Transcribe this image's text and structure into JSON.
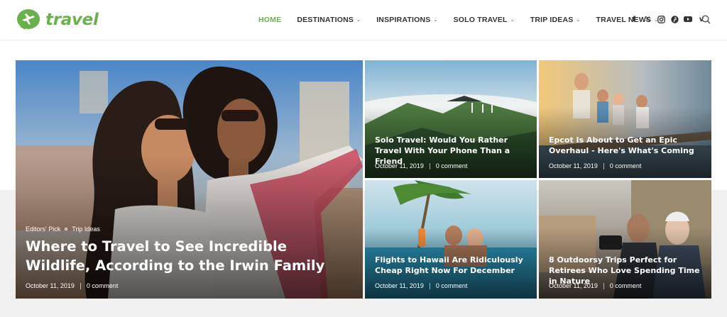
{
  "site": {
    "logo_text": "travel",
    "brand_color": "#6ab04c"
  },
  "nav": {
    "items": [
      {
        "label": "HOME",
        "active": true,
        "dropdown": false
      },
      {
        "label": "DESTINATIONS",
        "active": false,
        "dropdown": true
      },
      {
        "label": "INSPIRATIONS",
        "active": false,
        "dropdown": true
      },
      {
        "label": "SOLO TRAVEL",
        "active": false,
        "dropdown": true
      },
      {
        "label": "TRIP IDEAS",
        "active": false,
        "dropdown": true
      },
      {
        "label": "TRAVEL NEWS",
        "active": false,
        "dropdown": true
      }
    ]
  },
  "social": [
    "facebook-icon",
    "x-icon",
    "instagram-icon",
    "pinterest-icon",
    "youtube-icon",
    "vimeo-icon"
  ],
  "featured": {
    "categories": [
      "Editors' Pick",
      "Trip Ideas"
    ],
    "title": "Where to Travel to See Incredible Wildlife, According to the Irwin Family",
    "date": "October 11, 2019",
    "comments": "0 comment"
  },
  "posts": [
    {
      "title": "Solo Travel: Would You Rather Travel With Your Phone Than a Friend",
      "date": "October 11, 2019",
      "comments": "0 comment"
    },
    {
      "title": "Epcot Is About to Get an Epic Overhaul - Here's What's Coming",
      "date": "October 11, 2019",
      "comments": "0 comment"
    },
    {
      "title": "Flights to Hawaii Are Ridiculously Cheap Right Now For December",
      "date": "October 11, 2019",
      "comments": "0 comment"
    },
    {
      "title": "8 Outdoorsy Trips Perfect for Retirees Who Love Spending Time in Nature",
      "date": "October 11, 2019",
      "comments": "0 comment"
    }
  ]
}
